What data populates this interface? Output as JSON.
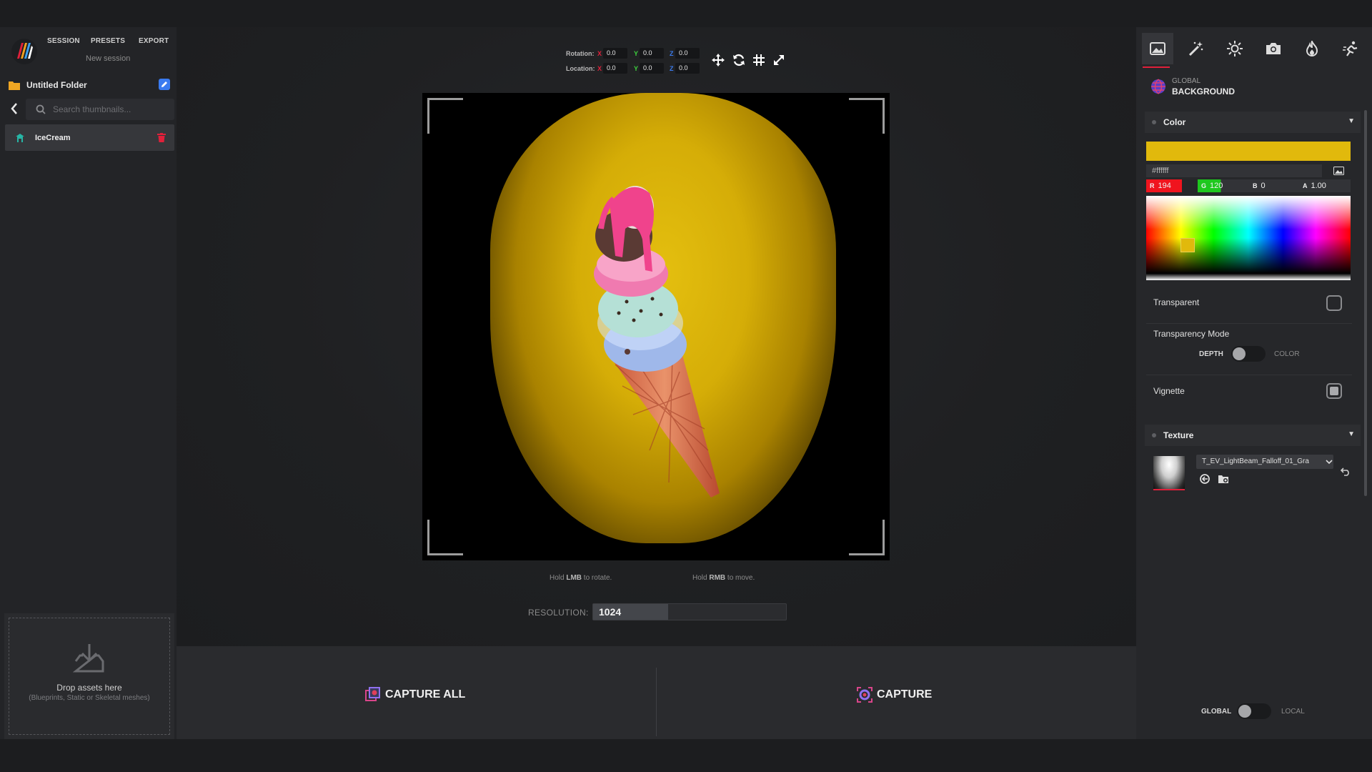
{
  "top_nav": {
    "session": "SESSION",
    "presets": "PRESETS",
    "export": "EXPORT",
    "subtitle": "New session"
  },
  "folder": {
    "name": "Untitled Folder"
  },
  "search": {
    "placeholder": "Search thumbnails..."
  },
  "assets": [
    {
      "name": "IceCream"
    }
  ],
  "drop_zone": {
    "title": "Drop assets here",
    "subtitle": "(Blueprints, Static or Skeletal meshes)"
  },
  "transform": {
    "rotation_label": "Rotation:",
    "location_label": "Location:",
    "axes": [
      "X",
      "Y",
      "Z"
    ],
    "rotation": [
      "0.0",
      "0.0",
      "0.0"
    ],
    "location": [
      "0.0",
      "0.0",
      "0.0"
    ]
  },
  "viewport_tools": [
    "move-icon",
    "reset-icon",
    "grid-icon",
    "fullscreen-icon"
  ],
  "hints": {
    "rotate": {
      "prefix": "Hold ",
      "key": "LMB",
      "suffix": " to rotate."
    },
    "move": {
      "prefix": "Hold ",
      "key": "RMB",
      "suffix": " to move."
    }
  },
  "resolution": {
    "label": "RESOLUTION:",
    "value": "1024",
    "slider_fraction": 0.39
  },
  "capture": {
    "all_label": "CAPTURE ALL",
    "single_label": "CAPTURE"
  },
  "right_tabs": [
    "background-icon",
    "magic-wand-icon",
    "light-icon",
    "camera-icon",
    "fire-icon",
    "animation-icon"
  ],
  "panel": {
    "scope": "GLOBAL",
    "title": "BACKGROUND"
  },
  "color_section": {
    "title": "Color",
    "swatch": "#e1b90c",
    "hex": "#ffffff",
    "r_label": "R",
    "r": "194",
    "g_label": "G",
    "g": "120",
    "b_label": "B",
    "b": "0",
    "a_label": "A",
    "a": "1.00"
  },
  "options": {
    "transparent": "Transparent",
    "transparency_mode": "Transparency Mode",
    "depth": "DEPTH",
    "color": "COLOR",
    "vignette": "Vignette"
  },
  "texture_section": {
    "title": "Texture",
    "texture_name": "T_EV_LightBeam_Falloff_01_Gra"
  },
  "scope_toggle": {
    "left": "GLOBAL",
    "right": "LOCAL"
  },
  "colors": {
    "accent": "#e0203a",
    "background_color": "#e1b90c",
    "panel": "#26272a"
  }
}
